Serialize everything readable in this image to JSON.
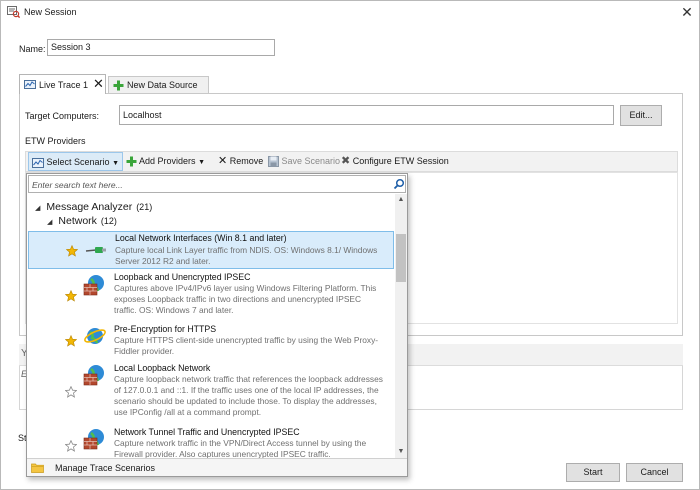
{
  "window": {
    "title": "New Session",
    "close_icon": "close-icon"
  },
  "session": {
    "name_label": "Name:",
    "name_value": "Session 3"
  },
  "tabs": [
    {
      "label": "Live Trace 1",
      "icon": "live-trace-icon",
      "active": true
    },
    {
      "label": "New Data Source",
      "icon": "add-icon",
      "active": false
    }
  ],
  "target": {
    "label": "Target Computers:",
    "value": "Localhost",
    "edit_label": "Edit..."
  },
  "etw": {
    "label": "ETW Providers",
    "toolbar": {
      "select_scenario": "Select Scenario",
      "add_providers": "Add Providers",
      "remove": "Remove",
      "save_scenario": "Save Scenario",
      "configure": "Configure ETW Session"
    }
  },
  "popup": {
    "search_placeholder": "Enter search text here...",
    "root": {
      "label": "Message Analyzer",
      "count": "(21)"
    },
    "group": {
      "label": "Network",
      "count": "(12)"
    },
    "items": [
      {
        "title": "Local Network Interfaces (Win 8.1 and later)",
        "desc": "Capture local Link Layer traffic from NDIS.  OS:  Windows 8.1/ Windows Server 2012 R2 and later.",
        "favorite": true,
        "icon": "network-cable-icon",
        "selected": true
      },
      {
        "title": "Loopback and Unencrypted IPSEC",
        "desc": "Captures above IPv4/IPv6 layer using Windows Filtering Platform. This exposes Loopback traffic in two directions and unencrypted IPSEC traffic. OS:  Windows 7 and later.",
        "favorite": true,
        "icon": "globe-firewall-icon",
        "selected": false
      },
      {
        "title": "Pre-Encryption for HTTPS",
        "desc": "Capture HTTPS client-side unencrypted traffic by using the Web Proxy-Fiddler provider.",
        "favorite": true,
        "icon": "ie-globe-icon",
        "selected": false
      },
      {
        "title": "Local Loopback Network",
        "desc": "Capture loopback network traffic that references the loopback addresses of 127.0.0.1 and ::1.  If the traffic uses one of the local IP addresses, the scenario should be updated to include those.  To display the addresses, use IPConfig /all at a command prompt.",
        "favorite": false,
        "icon": "globe-firewall-icon",
        "selected": false
      },
      {
        "title": "Network Tunnel Traffic and Unencrypted IPSEC",
        "desc": "Capture network traffic in the VPN/Direct Access tunnel by using the Firewall provider.  Also captures unencrypted IPSEC traffic.",
        "favorite": false,
        "icon": "globe-firewall-icon",
        "selected": false
      }
    ],
    "footer": "Manage Trace Scenarios"
  },
  "lower": {
    "frag_glyph": "Y",
    "frag_text": "En",
    "frag_label": "St"
  },
  "buttons": {
    "start": "Start",
    "cancel": "Cancel"
  },
  "colors": {
    "selection_bg": "#d9ecfb",
    "selection_border": "#7fbde9",
    "star_gold": "#f2b705"
  }
}
